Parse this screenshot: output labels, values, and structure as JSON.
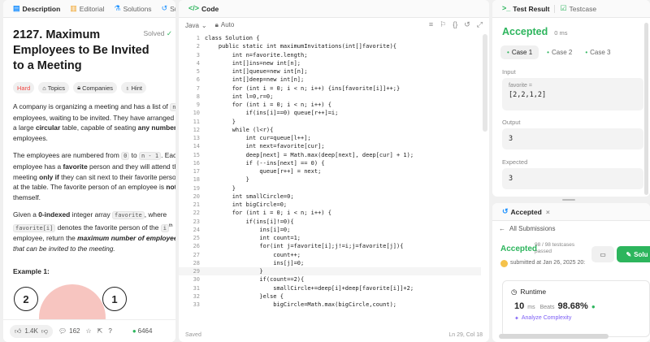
{
  "left": {
    "tabs": [
      {
        "label": "Description",
        "icon": "document-icon"
      },
      {
        "label": "Editorial",
        "icon": "book-icon"
      },
      {
        "label": "Solutions",
        "icon": "flask-icon"
      },
      {
        "label": "Su",
        "icon": "history-icon"
      }
    ],
    "title": "2127. Maximum Employees to Be Invited to a Meeting",
    "solved": "Solved",
    "chips": {
      "hard": "Hard",
      "topics": "Topics",
      "companies": "Companies",
      "hint": "Hint"
    },
    "desc": {
      "p1": {
        "l1a": "A company is organizing a meeting and has a list of ",
        "l1code": "n",
        "l2": "employees, waiting to be invited. They have arranged fo",
        "l3a": "a large ",
        "l3b": "circular",
        "l3c": " table, capable of seating ",
        "l3d": "any number",
        "l4": "employees."
      },
      "p2": {
        "l1a": "The employees are numbered from ",
        "l1code1": "0",
        "l1b": " to ",
        "l1code2": "n - 1",
        "l1c": ". Each",
        "l2a": "employee has a ",
        "l2b": "favorite",
        "l2c": " person and they will attend th",
        "l3a": "meeting ",
        "l3b": "only if",
        "l3c": " they can sit next to their favorite perso",
        "l4a": "at the table. The favorite person of an employee is ",
        "l4b": "not",
        "l5": "themself."
      },
      "p3": {
        "l1a": "Given a ",
        "l1b": "0-indexed",
        "l1c": " integer array ",
        "l1code": "favorite",
        "l1d": ", where",
        "l2code": "favorite[i]",
        "l2a": " denotes the favorite person of the ",
        "l2code2": "i",
        "l2sup": "th",
        "l3a": "employee, return the ",
        "l3b": "maximum number of employees",
        "l4": "that can be invited to the meeting."
      }
    },
    "example": "Example 1:",
    "nodes": [
      "2",
      "1"
    ],
    "bottom": {
      "likes": "1.4K",
      "comments": "162",
      "online": "6464"
    }
  },
  "code": {
    "tab": "Code",
    "lang": "Java",
    "mode": "Auto",
    "lines": [
      "class Solution {",
      "    public static int maximumInvitations(int[]favorite){",
      "        int n=favorite.length;",
      "        int[]ins=new int[n];",
      "        int[]queue=new int[n];",
      "        int[]deep=new int[n];",
      "        for (int i = 0; i < n; i++) {ins[favorite[i]]++;}",
      "        int l=0,r=0;",
      "        for (int i = 0; i < n; i++) {",
      "            if(ins[i]==0) queue[r++]=i;",
      "        }",
      "        while (l<r){",
      "            int cur=queue[l++];",
      "            int next=favorite[cur];",
      "            deep[next] = Math.max(deep[next], deep[cur] + 1);",
      "            if (--ins[next] == 0) {",
      "                queue[r++] = next;",
      "            }",
      "        }",
      "        int smallCircle=0;",
      "        int bigCircle=0;",
      "        for (int i = 0; i < n; i++) {",
      "            if(ins[i]!=0){",
      "                ins[i]=0;",
      "                int count=1;",
      "                for(int j=favorite[i];j!=i;j=favorite[j]){",
      "                    count++;",
      "                    ins[j]=0;",
      "                }",
      "                if(count==2){",
      "                    smallCircle+=deep[i]+deep[favorite[i]]+2;",
      "                }else {",
      "                    bigCircle=Math.max(bigCircle,count);"
    ],
    "status_left": "Saved",
    "status_right": "Ln 29, Col 18"
  },
  "test": {
    "tab1": "Test Result",
    "tab2": "Testcase",
    "status": "Accepted",
    "time": "0 ms",
    "cases": [
      "Case 1",
      "Case 2",
      "Case 3"
    ],
    "input_label": "Input",
    "input_var": "favorite =",
    "input_val": "[2,2,1,2]",
    "output_label": "Output",
    "output_val": "3",
    "expected_label": "Expected",
    "expected_val": "3"
  },
  "submission": {
    "tab": "Accepted",
    "back": "All Submissions",
    "status": "Accepted",
    "passed_a": "98 / 98 testcases",
    "passed_b": "passed",
    "submitted": "submitted at Jan 26, 2025 20:",
    "solution_btn": "Solu",
    "runtime_label": "Runtime",
    "runtime_val": "10",
    "runtime_unit": "ms",
    "beats_label": "Beats",
    "beats_val": "98.68%",
    "analyze": "Analyze Complexity"
  }
}
